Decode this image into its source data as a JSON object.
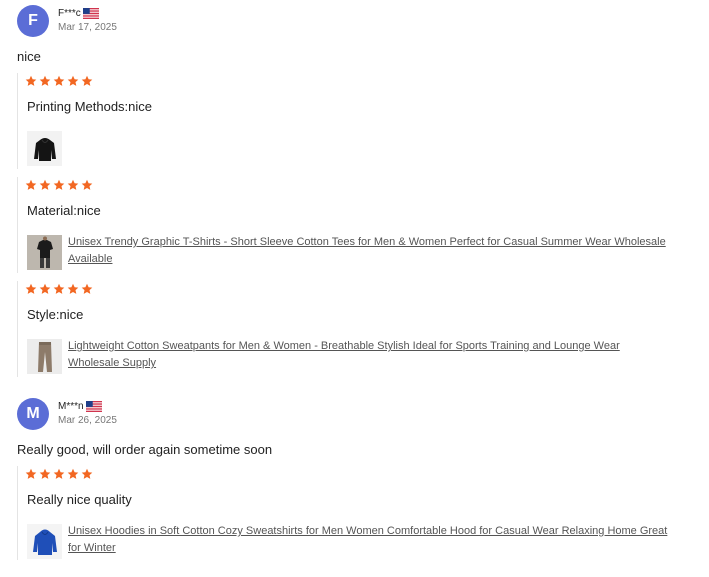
{
  "reviews": [
    {
      "avatar_letter": "F",
      "avatar_color": "#5b6dd6",
      "name": "F***c",
      "country_flag": "us-flag",
      "date": "Mar 17, 2025",
      "comment": "nice",
      "sub_reviews": [
        {
          "rating": 5,
          "text": "Printing Methods:nice",
          "product": ""
        },
        {
          "rating": 5,
          "text": "Material:nice",
          "product": "Unisex Trendy Graphic T-Shirts - Short Sleeve Cotton Tees for Men & Women Perfect for Casual Summer Wear Wholesale Available"
        },
        {
          "rating": 5,
          "text": "Style:nice",
          "product": "Lightweight Cotton Sweatpants for Men & Women - Breathable Stylish Ideal for Sports Training and Lounge Wear Wholesale Supply"
        }
      ]
    },
    {
      "avatar_letter": "M",
      "avatar_color": "#5b6dd6",
      "name": "M***n",
      "country_flag": "us-flag",
      "date": "Mar 26, 2025",
      "comment": "Really good, will order again sometime soon",
      "sub_reviews": [
        {
          "rating": 5,
          "text": "Really nice quality",
          "product": "Unisex Hoodies in Soft Cotton Cozy Sweatshirts for Men Women Comfortable Hood for Casual Wear Relaxing Home Great for Winter"
        }
      ]
    }
  ],
  "colors": {
    "star": "#f26722",
    "avatar": "#5b6dd6",
    "link": "#555555",
    "divider": "#e4e4e4"
  }
}
